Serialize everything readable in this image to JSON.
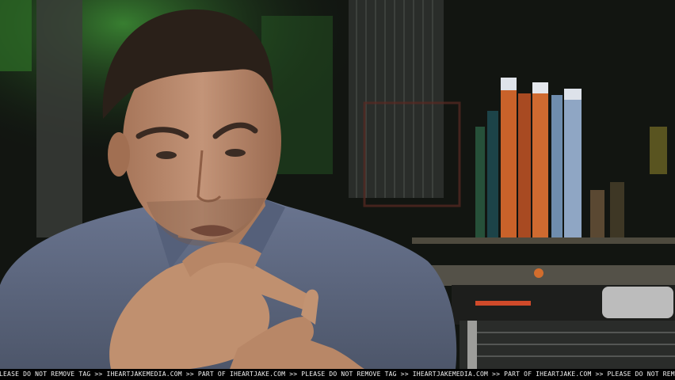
{
  "watermark": {
    "text": "PLEASE DO NOT REMOVE TAG >> IHEARTJAKEMEDIA.COM >> PART OF IHEARTJAKE.COM >> PLEASE DO NOT REMOVE TAG >> IHEARTJAKEMEDIA.COM >> PART OF IHEARTJAKE.COM >> PLEASE DO NOT REMOVE TAG >> IHEARTJAKEMEDIA.COM"
  },
  "palette": {
    "skin": "#b98a6c",
    "shirt": "#5f6a80",
    "hair": "#2a2019",
    "background_green": "#2f7a2a",
    "background_dark": "#141812",
    "tube_orange": "#c9622a",
    "tube_blue": "#8fa6c4"
  }
}
